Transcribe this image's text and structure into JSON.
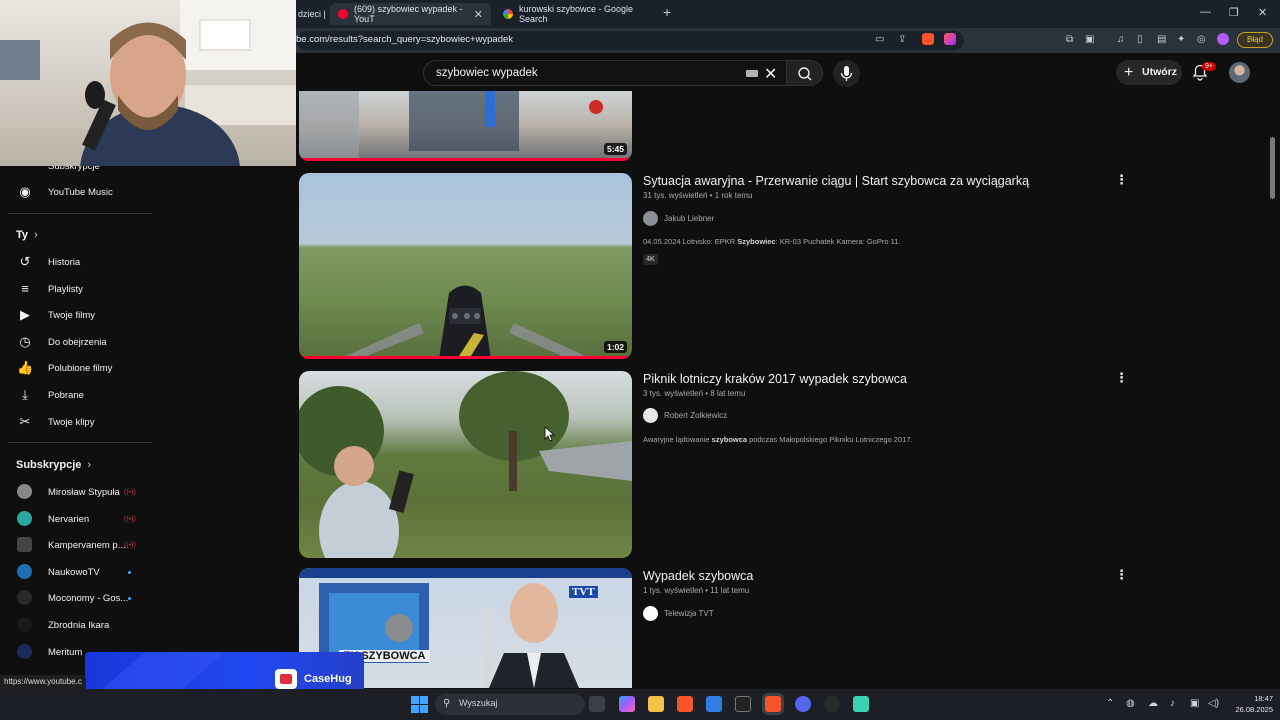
{
  "browser": {
    "tabs": [
      {
        "label": "dzieci |"
      },
      {
        "label": "(609) szybowiec wypadek - YouT"
      },
      {
        "label": "kurowski szybowce - Google Search"
      }
    ],
    "url": "be.com/results?search_query=szybowiec+wypadek",
    "profile_badge": "Błąd"
  },
  "youtube": {
    "search_query": "szybowiec wypadek",
    "create_label": "Utwórz",
    "notifications_count": "9+"
  },
  "sidebar": {
    "top_partial": "Subskrypcje",
    "youtube_music": "YouTube Music",
    "you_header": "Ty",
    "you_items": [
      "Historia",
      "Playlisty",
      "Twoje filmy",
      "Do obejrzenia",
      "Polubione filmy",
      "Pobrane",
      "Twoje klipy"
    ],
    "subs_header": "Subskrypcje",
    "subscriptions": [
      {
        "name": "Mirosław Stypuła",
        "live": "((•))"
      },
      {
        "name": "Nervarien",
        "live": "((•))"
      },
      {
        "name": "Kampervanem p...",
        "live": "((•))"
      },
      {
        "name": "NaukowoTV"
      },
      {
        "name": "Moconomy - Gos..."
      },
      {
        "name": "Zbrodnia Ikara"
      },
      {
        "name": "Meritum"
      }
    ]
  },
  "results": [
    {
      "duration": "5:45"
    },
    {
      "title": "Sytuacja awaryjna - Przerwanie ciągu | Start szybowca za wyciągarką",
      "meta": "31 tys. wyświetleń • 1 rok temu",
      "channel": "Jakub Liebner",
      "desc_pre": "04.05.2024 Lotnisko: EPKR ",
      "desc_bold": "Szybowiec",
      "desc_post": ": KR-03 Puchatek Kamera: GoPro 11.",
      "badge": "4K",
      "duration": "1:02"
    },
    {
      "title": "Piknik lotniczy kraków 2017 wypadek szybowca",
      "meta": "3 tys. wyświetleń • 8 lat temu",
      "channel": "Robert Zolkiewicz",
      "desc_pre": "Awaryjne lądowanie ",
      "desc_bold": "szybowca",
      "desc_post": " podczas Małopolskiego Pikniku Lotniczego 2017."
    },
    {
      "title": "Wypadek szybowca",
      "meta": "1 tys. wyświetleń • 11 lat temu",
      "channel": "Telewizja TVT",
      "thumb_caption": "EK SZYBOWCA",
      "thumb_logo": "TVT"
    }
  ],
  "status_url": "https://www.youtube.c",
  "promo_brand": "CaseHug",
  "taskbar": {
    "search_placeholder": "Wyszukaj",
    "time": "18:47",
    "date": "26.08.2025"
  }
}
